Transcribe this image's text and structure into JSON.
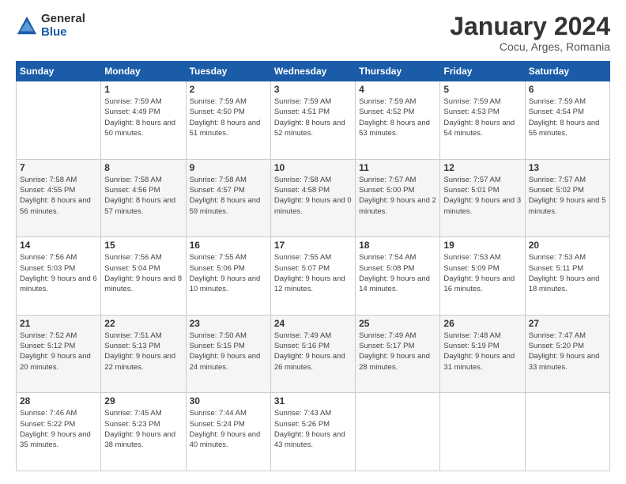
{
  "logo": {
    "general": "General",
    "blue": "Blue"
  },
  "title": "January 2024",
  "subtitle": "Cocu, Arges, Romania",
  "weekdays": [
    "Sunday",
    "Monday",
    "Tuesday",
    "Wednesday",
    "Thursday",
    "Friday",
    "Saturday"
  ],
  "weeks": [
    [
      {
        "day": "",
        "sunrise": "",
        "sunset": "",
        "daylight": ""
      },
      {
        "day": "1",
        "sunrise": "Sunrise: 7:59 AM",
        "sunset": "Sunset: 4:49 PM",
        "daylight": "Daylight: 8 hours and 50 minutes."
      },
      {
        "day": "2",
        "sunrise": "Sunrise: 7:59 AM",
        "sunset": "Sunset: 4:50 PM",
        "daylight": "Daylight: 8 hours and 51 minutes."
      },
      {
        "day": "3",
        "sunrise": "Sunrise: 7:59 AM",
        "sunset": "Sunset: 4:51 PM",
        "daylight": "Daylight: 8 hours and 52 minutes."
      },
      {
        "day": "4",
        "sunrise": "Sunrise: 7:59 AM",
        "sunset": "Sunset: 4:52 PM",
        "daylight": "Daylight: 8 hours and 53 minutes."
      },
      {
        "day": "5",
        "sunrise": "Sunrise: 7:59 AM",
        "sunset": "Sunset: 4:53 PM",
        "daylight": "Daylight: 8 hours and 54 minutes."
      },
      {
        "day": "6",
        "sunrise": "Sunrise: 7:59 AM",
        "sunset": "Sunset: 4:54 PM",
        "daylight": "Daylight: 8 hours and 55 minutes."
      }
    ],
    [
      {
        "day": "7",
        "sunrise": "Sunrise: 7:58 AM",
        "sunset": "Sunset: 4:55 PM",
        "daylight": "Daylight: 8 hours and 56 minutes."
      },
      {
        "day": "8",
        "sunrise": "Sunrise: 7:58 AM",
        "sunset": "Sunset: 4:56 PM",
        "daylight": "Daylight: 8 hours and 57 minutes."
      },
      {
        "day": "9",
        "sunrise": "Sunrise: 7:58 AM",
        "sunset": "Sunset: 4:57 PM",
        "daylight": "Daylight: 8 hours and 59 minutes."
      },
      {
        "day": "10",
        "sunrise": "Sunrise: 7:58 AM",
        "sunset": "Sunset: 4:58 PM",
        "daylight": "Daylight: 9 hours and 0 minutes."
      },
      {
        "day": "11",
        "sunrise": "Sunrise: 7:57 AM",
        "sunset": "Sunset: 5:00 PM",
        "daylight": "Daylight: 9 hours and 2 minutes."
      },
      {
        "day": "12",
        "sunrise": "Sunrise: 7:57 AM",
        "sunset": "Sunset: 5:01 PM",
        "daylight": "Daylight: 9 hours and 3 minutes."
      },
      {
        "day": "13",
        "sunrise": "Sunrise: 7:57 AM",
        "sunset": "Sunset: 5:02 PM",
        "daylight": "Daylight: 9 hours and 5 minutes."
      }
    ],
    [
      {
        "day": "14",
        "sunrise": "Sunrise: 7:56 AM",
        "sunset": "Sunset: 5:03 PM",
        "daylight": "Daylight: 9 hours and 6 minutes."
      },
      {
        "day": "15",
        "sunrise": "Sunrise: 7:56 AM",
        "sunset": "Sunset: 5:04 PM",
        "daylight": "Daylight: 9 hours and 8 minutes."
      },
      {
        "day": "16",
        "sunrise": "Sunrise: 7:55 AM",
        "sunset": "Sunset: 5:06 PM",
        "daylight": "Daylight: 9 hours and 10 minutes."
      },
      {
        "day": "17",
        "sunrise": "Sunrise: 7:55 AM",
        "sunset": "Sunset: 5:07 PM",
        "daylight": "Daylight: 9 hours and 12 minutes."
      },
      {
        "day": "18",
        "sunrise": "Sunrise: 7:54 AM",
        "sunset": "Sunset: 5:08 PM",
        "daylight": "Daylight: 9 hours and 14 minutes."
      },
      {
        "day": "19",
        "sunrise": "Sunrise: 7:53 AM",
        "sunset": "Sunset: 5:09 PM",
        "daylight": "Daylight: 9 hours and 16 minutes."
      },
      {
        "day": "20",
        "sunrise": "Sunrise: 7:53 AM",
        "sunset": "Sunset: 5:11 PM",
        "daylight": "Daylight: 9 hours and 18 minutes."
      }
    ],
    [
      {
        "day": "21",
        "sunrise": "Sunrise: 7:52 AM",
        "sunset": "Sunset: 5:12 PM",
        "daylight": "Daylight: 9 hours and 20 minutes."
      },
      {
        "day": "22",
        "sunrise": "Sunrise: 7:51 AM",
        "sunset": "Sunset: 5:13 PM",
        "daylight": "Daylight: 9 hours and 22 minutes."
      },
      {
        "day": "23",
        "sunrise": "Sunrise: 7:50 AM",
        "sunset": "Sunset: 5:15 PM",
        "daylight": "Daylight: 9 hours and 24 minutes."
      },
      {
        "day": "24",
        "sunrise": "Sunrise: 7:49 AM",
        "sunset": "Sunset: 5:16 PM",
        "daylight": "Daylight: 9 hours and 26 minutes."
      },
      {
        "day": "25",
        "sunrise": "Sunrise: 7:49 AM",
        "sunset": "Sunset: 5:17 PM",
        "daylight": "Daylight: 9 hours and 28 minutes."
      },
      {
        "day": "26",
        "sunrise": "Sunrise: 7:48 AM",
        "sunset": "Sunset: 5:19 PM",
        "daylight": "Daylight: 9 hours and 31 minutes."
      },
      {
        "day": "27",
        "sunrise": "Sunrise: 7:47 AM",
        "sunset": "Sunset: 5:20 PM",
        "daylight": "Daylight: 9 hours and 33 minutes."
      }
    ],
    [
      {
        "day": "28",
        "sunrise": "Sunrise: 7:46 AM",
        "sunset": "Sunset: 5:22 PM",
        "daylight": "Daylight: 9 hours and 35 minutes."
      },
      {
        "day": "29",
        "sunrise": "Sunrise: 7:45 AM",
        "sunset": "Sunset: 5:23 PM",
        "daylight": "Daylight: 9 hours and 38 minutes."
      },
      {
        "day": "30",
        "sunrise": "Sunrise: 7:44 AM",
        "sunset": "Sunset: 5:24 PM",
        "daylight": "Daylight: 9 hours and 40 minutes."
      },
      {
        "day": "31",
        "sunrise": "Sunrise: 7:43 AM",
        "sunset": "Sunset: 5:26 PM",
        "daylight": "Daylight: 9 hours and 43 minutes."
      },
      {
        "day": "",
        "sunrise": "",
        "sunset": "",
        "daylight": ""
      },
      {
        "day": "",
        "sunrise": "",
        "sunset": "",
        "daylight": ""
      },
      {
        "day": "",
        "sunrise": "",
        "sunset": "",
        "daylight": ""
      }
    ]
  ]
}
